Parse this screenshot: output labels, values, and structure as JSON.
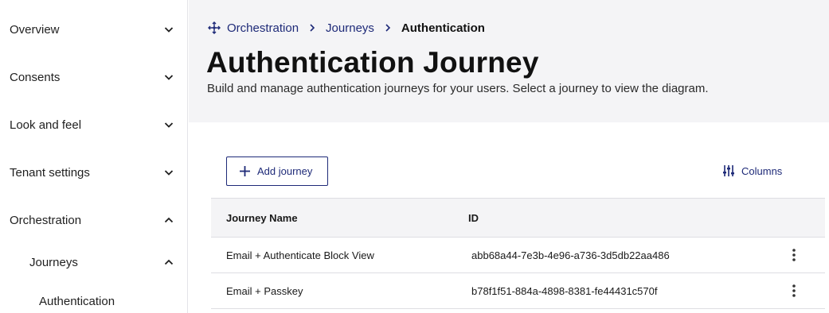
{
  "sidebar": {
    "items": [
      {
        "label": "Overview",
        "chevron": "chevron-down-icon"
      },
      {
        "label": "Consents",
        "chevron": "chevron-down-icon"
      },
      {
        "label": "Look and feel",
        "chevron": "chevron-down-icon"
      },
      {
        "label": "Tenant settings",
        "chevron": "chevron-down-icon"
      },
      {
        "label": "Orchestration",
        "chevron": "chevron-up-icon"
      },
      {
        "label": "Journeys",
        "chevron": "chevron-up-icon"
      },
      {
        "label": "Authentication"
      }
    ]
  },
  "breadcrumb": {
    "icon": "orchestration-icon",
    "items": [
      "Orchestration",
      "Journeys",
      "Authentication"
    ]
  },
  "header": {
    "title": "Authentication Journey",
    "description": "Build and manage authentication journeys for your users. Select a journey to view the diagram."
  },
  "toolbar": {
    "add_label": "Add journey",
    "columns_label": "Columns"
  },
  "table": {
    "columns": [
      "Journey Name",
      "ID"
    ],
    "rows": [
      {
        "name": "Email + Authenticate Block View",
        "id": "abb68a44-7e3b-4e96-a736-3d5db22aa486"
      },
      {
        "name": "Email + Passkey",
        "id": "b78f1f51-884a-4898-8381-fe44431c570f"
      }
    ]
  },
  "colors": {
    "accent": "#1e2a78",
    "header_bg": "#f4f4f6",
    "border": "#dedee3"
  }
}
